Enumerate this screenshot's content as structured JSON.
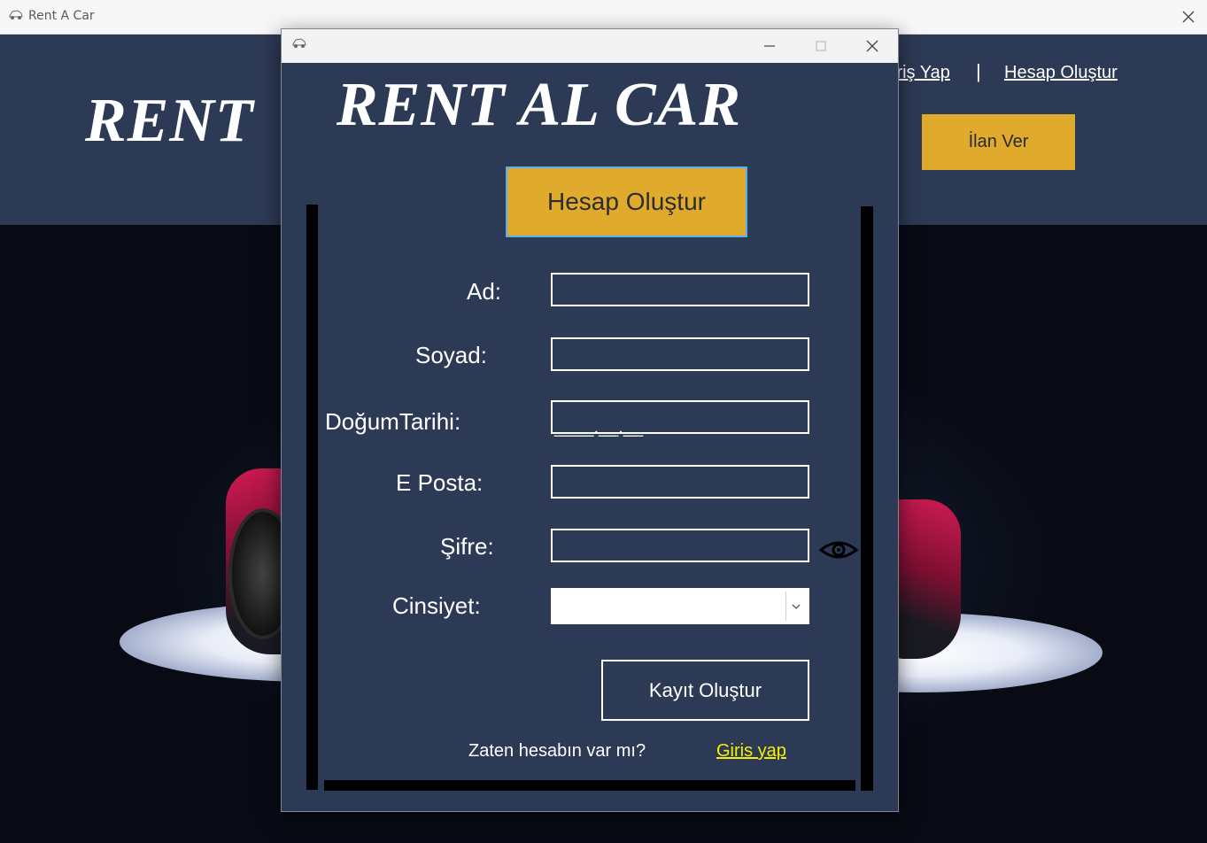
{
  "main_window": {
    "title": "Rent A Car",
    "brand": "RENT",
    "nav": {
      "login": "iriş Yap",
      "separator": "|",
      "register": "Hesap Oluştur"
    },
    "post_ad_button": "İlan Ver"
  },
  "dialog": {
    "brand": "RENT AL CAR",
    "header_button": "Hesap Oluştur",
    "form": {
      "ad_label": "Ad:",
      "soyad_label": "Soyad:",
      "dogum_label": "DoğumTarihi:",
      "dogum_mask": "____.__.__",
      "eposta_label": "E Posta:",
      "sifre_label": "Şifre:",
      "cinsiyet_label": "Cinsiyet:",
      "ad_value": "",
      "soyad_value": "",
      "eposta_value": "",
      "sifre_value": "",
      "cinsiyet_value": ""
    },
    "submit_button": "Kayıt Oluştur",
    "footer": {
      "prompt": "Zaten hesabın var mı?",
      "login_link": "Giris yap"
    }
  },
  "colors": {
    "panel": "#2d3a55",
    "accent": "#e0ab2c",
    "link": "#f4f000",
    "focus": "#56b0f0"
  },
  "icons": [
    "app-icon",
    "close-icon",
    "minimize-icon",
    "maximize-icon",
    "eye-icon",
    "chevron-down-icon"
  ]
}
